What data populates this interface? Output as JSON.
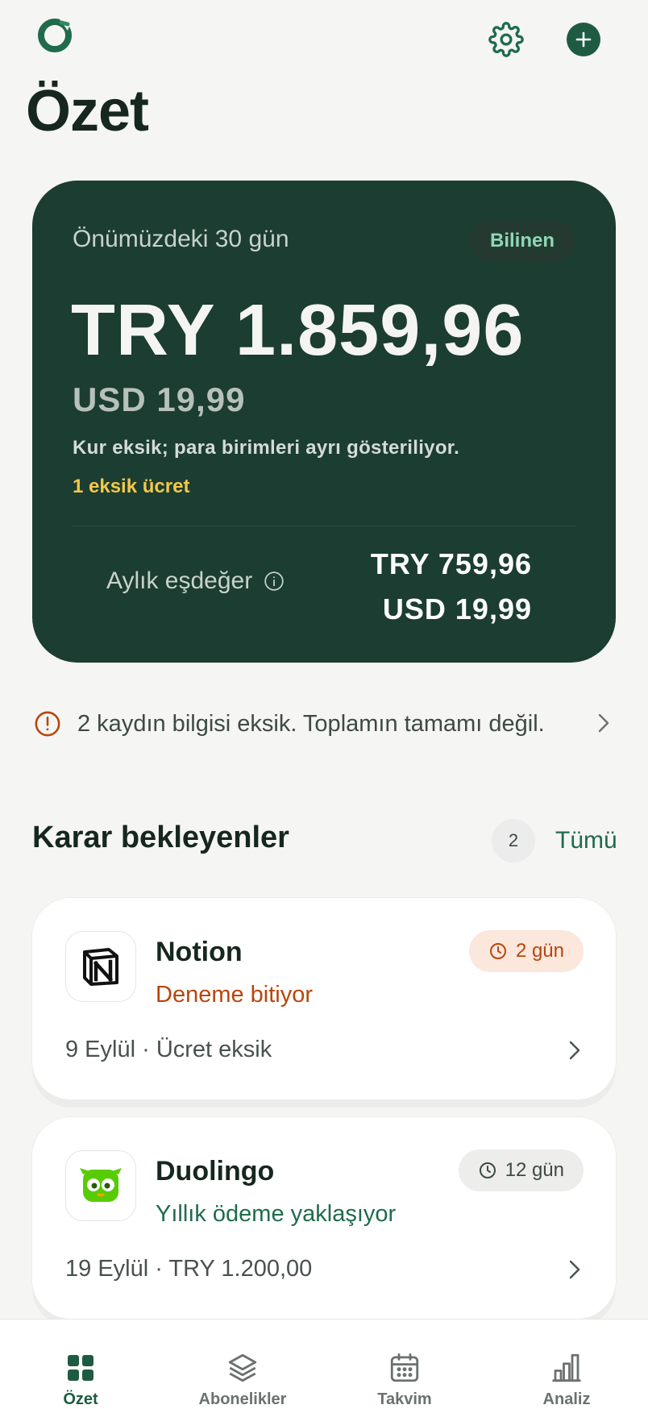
{
  "header": {
    "title": "Özet",
    "icons": {
      "logo": "app-logo",
      "settings": "gear-icon",
      "add": "plus-icon"
    }
  },
  "summary": {
    "period": "Önümüzdeki 30 gün",
    "badge": "Bilinen",
    "primary_amount": "TRY 1.859,96",
    "secondary_amount": "USD 19,99",
    "note": "Kur eksik; para birimleri ayrı gösteriliyor.",
    "missing": "1 eksik ücret",
    "monthly_label": "Aylık eşdeğer",
    "monthly_values": [
      "TRY 759,96",
      "USD 19,99"
    ]
  },
  "alert": {
    "text": "2 kaydın bilgisi eksik. Toplamın tamamı değil."
  },
  "pending": {
    "title": "Karar bekleyenler",
    "count": "2",
    "all_label": "Tümü",
    "items": [
      {
        "name": "Notion",
        "status": "Deneme bitiyor",
        "badge": "2 gün",
        "meta": "9 Eylül · Ücret eksik"
      },
      {
        "name": "Duolingo",
        "status": "Yıllık ödeme yaklaşıyor",
        "badge": "12 gün",
        "meta": "19 Eylül · TRY 1.200,00"
      }
    ]
  },
  "tabs": [
    {
      "label": "Özet",
      "icon": "grid-icon",
      "active": true
    },
    {
      "label": "Abonelikler",
      "icon": "layers-icon",
      "active": false
    },
    {
      "label": "Takvim",
      "icon": "calendar-icon",
      "active": false
    },
    {
      "label": "Analiz",
      "icon": "bar-chart-icon",
      "active": false
    }
  ],
  "colors": {
    "primary": "#1f5b43",
    "hero_bg": "#1c3d31",
    "warning": "#f2c84b",
    "orange": "#b8450d",
    "page_bg": "#f5f5f3"
  }
}
